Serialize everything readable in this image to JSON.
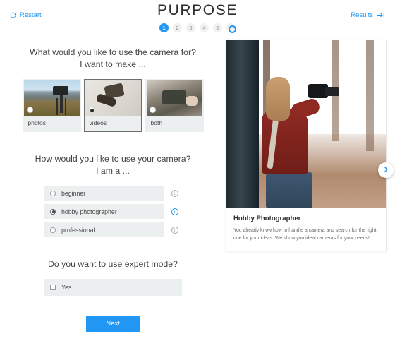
{
  "header": {
    "title": "PURPOSE",
    "restart_label": "Restart",
    "restart_icon": "refresh-icon",
    "results_label": "Results",
    "results_icon": "arrow-to-end-icon",
    "accent_color": "#2196f3",
    "steps": [
      {
        "label": "1",
        "state": "active"
      },
      {
        "label": "2",
        "state": "inactive"
      },
      {
        "label": "3",
        "state": "inactive"
      },
      {
        "label": "4",
        "state": "inactive"
      },
      {
        "label": "5",
        "state": "inactive"
      },
      {
        "label": "",
        "state": "icon",
        "icon": "results-circle-icon"
      }
    ]
  },
  "questions": {
    "purpose": {
      "title": "What would you like to use the camera for?",
      "subtitle": "I want to make ...",
      "options": [
        {
          "label": "photos",
          "selected": false,
          "thumb": "camera-on-tripod-mountains"
        },
        {
          "label": "videos",
          "selected": true,
          "thumb": "gimbal-camera-in-hand"
        },
        {
          "label": "both",
          "selected": false,
          "thumb": "hands-holding-camera"
        }
      ]
    },
    "skill": {
      "title": "How would you like to use your camera?",
      "subtitle": "I am a ...",
      "options": [
        {
          "label": "beginner",
          "selected": false,
          "info_icon": "info-icon"
        },
        {
          "label": "hobby photographer",
          "selected": true,
          "info_icon": "info-icon"
        },
        {
          "label": "professional",
          "selected": false,
          "info_icon": "info-icon"
        }
      ]
    },
    "expert": {
      "title": "Do you want to use expert mode?",
      "checkbox_label": "Yes",
      "checked": false
    }
  },
  "preview": {
    "image_alt": "woman-photographing-in-autumn-forest",
    "title": "Hobby Photographer",
    "description": "You already know how to handle a camera and search for the right one for your ideas. We show you ideal cameras for your needs!",
    "next_icon": "chevron-right-icon"
  },
  "footer": {
    "next_label": "Next"
  }
}
